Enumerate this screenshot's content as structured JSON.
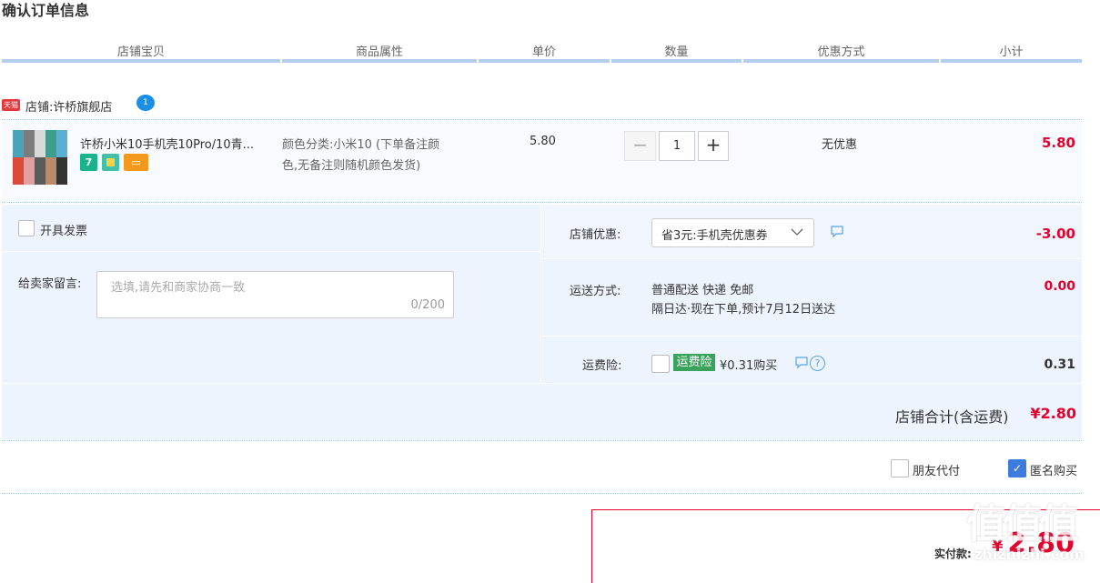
{
  "page_title": "确认订单信息",
  "columns": [
    "店铺宝贝",
    "商品属性",
    "单价",
    "数量",
    "优惠方式",
    "小计"
  ],
  "shop": {
    "tmall_badge": "天猫",
    "label": "店铺:",
    "name": "许桥旗舰店",
    "chat_badge": "1"
  },
  "item": {
    "title": "许桥小米10手机壳10Pro/10青...",
    "tags": [
      "7",
      "",
      "▭"
    ],
    "attr_line1": "颜色分类:小米10 (下单备注颜",
    "attr_line2": "色,无备注则随机颜色发货)",
    "unit_price": "5.80",
    "minus": "−",
    "quantity": "1",
    "plus": "+",
    "discount": "无优惠",
    "subtotal": "5.80"
  },
  "invoice": {
    "label": "开具发票"
  },
  "message": {
    "label": "给卖家留言:",
    "placeholder": "选填,请先和商家协商一致",
    "counter": "0/200"
  },
  "store_discount": {
    "label": "店铺优惠:",
    "selected": "省3元:手机壳优惠券",
    "amount": "-3.00"
  },
  "shipping": {
    "label": "运送方式:",
    "line1": "普通配送 快递 免邮",
    "line2": "隔日达·现在下单,预计7月12日送达",
    "amount": "0.00"
  },
  "insurance": {
    "label": "运费险:",
    "badge": "运费险",
    "price": "¥0.31购买",
    "help": "?",
    "amount": "0.31"
  },
  "store_total": {
    "label": "店铺合计(含运费)",
    "amount": "¥2.80"
  },
  "options": {
    "friend_pay": "朋友代付",
    "anonymous": "匿名购买",
    "anonymous_checked": true
  },
  "payment": {
    "label": "实付款:",
    "currency": "¥",
    "amount": "2.80"
  },
  "watermark": {
    "text": "值值值",
    "url": "zhizhizhi.com"
  },
  "colors": {
    "accent": "#e4002b",
    "header_line": "#b3cff0",
    "panel": "#eef4fe",
    "insurance_green": "#3aa35b",
    "checkbox_blue": "#3e7bde"
  }
}
